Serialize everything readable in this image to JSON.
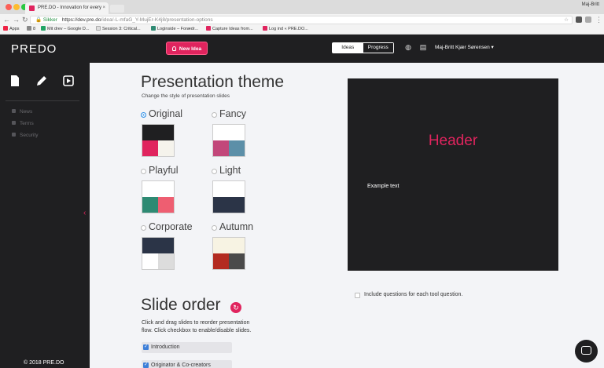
{
  "browser": {
    "tab_title": "PRE.DO - Innovation for every",
    "tab_close": "×",
    "window_user": "Maj-Britt",
    "secure_label": "Sikker",
    "url_host": "https://dev.pre.do",
    "url_path": "/idea/-L-mfaG_Y-MujEr-K4j8/presentation-options",
    "bookmarks": [
      "Apps",
      "8",
      "Mit drev – Google D...",
      "Session 3: Critical...",
      "Loginside – Forædr...",
      "Capture Ideas from...",
      "Log ind « PRE.DO..."
    ]
  },
  "header": {
    "logo": "PREDO",
    "new_idea_label": "New Idea",
    "tabs": [
      {
        "label": "Ideas",
        "active": true
      },
      {
        "label": "Progress",
        "active": false
      }
    ],
    "user_name": "Maj-Britt Kjær Sørensen ▾"
  },
  "sidebar": {
    "items": [
      {
        "label": "News",
        "icon": "news-icon"
      },
      {
        "label": "Terms",
        "icon": "terms-icon"
      },
      {
        "label": "Security",
        "icon": "security-icon"
      }
    ],
    "copyright": "© 2018 PRE.DO"
  },
  "theme": {
    "title": "Presentation theme",
    "subtitle": "Change the style of presentation slides",
    "options": [
      {
        "label": "Original",
        "selected": true,
        "colors": {
          "top": "#1f1f21",
          "bl": "#e0245e",
          "br": "#f5f3ec"
        }
      },
      {
        "label": "Fancy",
        "selected": false,
        "colors": {
          "top": "#ffffff",
          "bl": "#c2477a",
          "br": "#5c8fa8"
        }
      },
      {
        "label": "Playful",
        "selected": false,
        "colors": {
          "top": "#ffffff",
          "bl": "#2e8a73",
          "br": "#ee5e71"
        }
      },
      {
        "label": "Light",
        "selected": false,
        "colors": {
          "top": "#ffffff",
          "bl": "#2b3447",
          "br": "#2b3447"
        }
      },
      {
        "label": "Corporate",
        "selected": false,
        "colors": {
          "top": "#2b3447",
          "bl": "#ffffff",
          "br": "#dcdcdc"
        }
      },
      {
        "label": "Autumn",
        "selected": false,
        "colors": {
          "top": "#f7f3e3",
          "bl": "#b32b20",
          "br": "#4a4a4a"
        }
      }
    ]
  },
  "preview": {
    "header": "Header",
    "text": "Example text",
    "bg": "#1f1f21",
    "accent": "#e0245e"
  },
  "include_questions": {
    "label": "Include questions for each tool question.",
    "checked": false
  },
  "slide_order": {
    "title": "Slide order",
    "desc_line1": "Click and drag slides to reorder presentation",
    "desc_line2": "flow. Click checkbox to enable/disable slides.",
    "slides": [
      {
        "label": "Introduction",
        "checked": true
      },
      {
        "label": "Originator & Co-creators",
        "checked": true
      }
    ]
  }
}
